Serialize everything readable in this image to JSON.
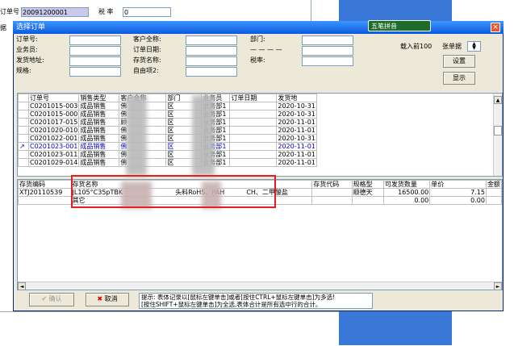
{
  "background": {
    "order_no_label": "订单号",
    "order_no_value": "20091200001",
    "tax_label": "税  率",
    "tax_value": "0",
    "left_stub": "据"
  },
  "dialog": {
    "title": "选择订单",
    "close_glyph": "×",
    "ime_label": "五笔拼音"
  },
  "filters": {
    "order_no": "订单号:",
    "salesman": "业务员:",
    "ship_addr": "发货地址:",
    "spec": "规格:",
    "customer": "客户全称:",
    "order_date": "订单日期:",
    "item_name": "存货名称:",
    "custom2": "自由项2:",
    "dept": "部门:",
    "dash": "— — — —",
    "tax_rate": "税率:"
  },
  "controls": {
    "load_prefix": "载入前100",
    "load_suffix": "张单据",
    "settings": "设置",
    "display": "显示",
    "confirm": "确认",
    "cancel": "取消"
  },
  "orders": {
    "headers": [
      "订单号",
      "销售类型",
      "客户全称",
      "部门",
      "业务员",
      "订单日期",
      "发货地"
    ],
    "rows": [
      [
        "C0201015-003",
        "成品销售",
        "佛",
        "区",
        "业务部1",
        "",
        "2020-10-31"
      ],
      [
        "C0201015-000",
        "成品销售",
        "佛",
        "区",
        "业务部1",
        "",
        "2020-10-31"
      ],
      [
        "C0201017-015",
        "成品销售",
        "顾",
        "区",
        "业务部1",
        "",
        "2020-11-01"
      ],
      [
        "C0201020-010",
        "成品销售",
        "佛",
        "区",
        "业务部1",
        "",
        "2020-11-01"
      ],
      [
        "C0201022-001",
        "成品销售",
        "佛",
        "区",
        "业务部1",
        "",
        "2020-10-31"
      ],
      [
        "C0201023-001",
        "成品销售",
        "佛",
        "区",
        "业务部1",
        "",
        "2020-11-01"
      ],
      [
        "C0201023-011",
        "成品销售",
        "佛",
        "区",
        "业务部1",
        "",
        "2020-11-01"
      ],
      [
        "C0201029-014",
        "成品销售",
        "佛",
        "区",
        "业务部1",
        "",
        "2020-11-01"
      ]
    ]
  },
  "items": {
    "headers": [
      "存货编码",
      "存货名称",
      "存货代码",
      "规格型",
      "可发货数量",
      "单价",
      "金额"
    ],
    "row1": {
      "code": "XTJ20110539",
      "name_start": "JL105°C35pTBK",
      "name_mid": "头料RoHS、PAH",
      "name_end": "CH、二甲酸盐",
      "spec": "顺德天",
      "qty": "16500.00",
      "price": "7.15"
    },
    "row2": {
      "label": "其它",
      "qty": "0.00",
      "price": "0.00"
    }
  },
  "hint": {
    "line1": "提示: 表体记录以[鼠标左键单击]或者[按住CTRL+鼠标左键单击]为多选!",
    "line2": "[按住SHIFT+鼠标左键单击]为全选,表体合计是所有选中行的合计。"
  },
  "colors": {
    "title_bar": "#0a5ae0",
    "highlight_border": "#e02020",
    "ime_bar": "#1e6b2a",
    "selected_row_text": "#0000cc"
  }
}
